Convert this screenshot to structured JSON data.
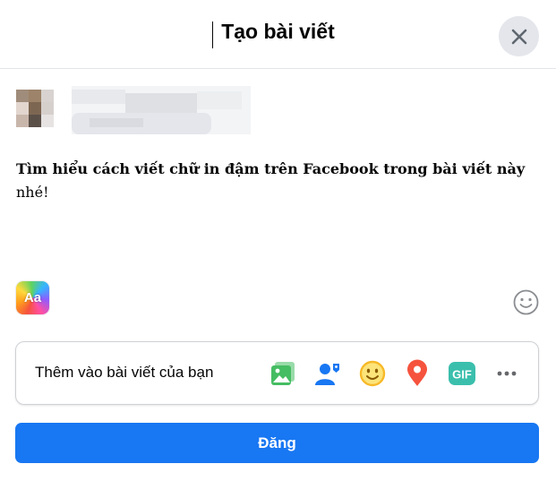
{
  "dialog": {
    "title": "Tạo bài viết",
    "close_icon": "close-icon"
  },
  "composer": {
    "text_bold": "Tìm hiểu cách viết chữ in đậm trên Facebook trong bài viết này",
    "text_tail": "nhé!",
    "background_picker_label": "Aa",
    "emoji_icon": "smiley-icon"
  },
  "add_to_post": {
    "label": "Thêm vào bài viết của bạn",
    "tools": [
      "photo-video-icon",
      "tag-people-icon",
      "feeling-icon",
      "check-in-icon",
      "gif-icon",
      "more-icon"
    ],
    "gif_label": "GIF"
  },
  "footer": {
    "post_label": "Đăng"
  },
  "colors": {
    "accent": "#1877f2",
    "photo": "#45bd62",
    "tag": "#1877f2",
    "feeling": "#f7b928",
    "checkin": "#f5533d",
    "gif": "#3bbfad"
  }
}
